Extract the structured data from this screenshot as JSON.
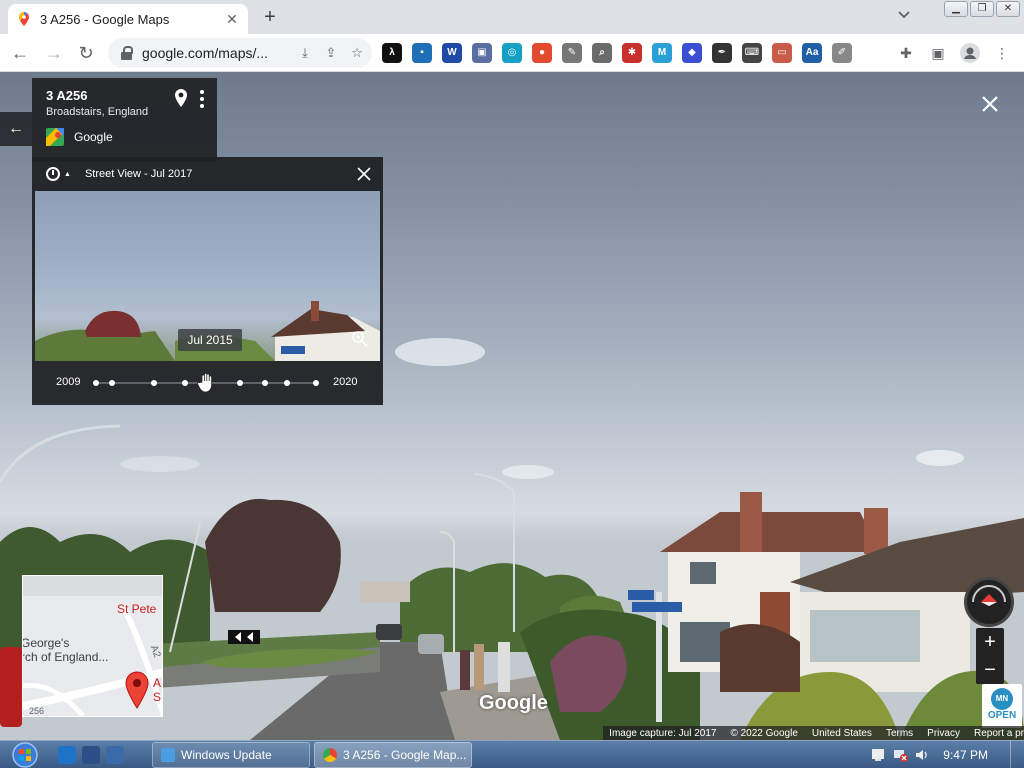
{
  "browser": {
    "tab_title": "3 A256 - Google Maps",
    "url": "google.com/maps/...",
    "new_tab_symbol": "+",
    "extensions": [
      {
        "name": "lambda-extension-icon",
        "color": "#111111",
        "glyph": "λ"
      },
      {
        "name": "flag-extension-icon",
        "color": "#1e6fb5",
        "glyph": "▪"
      },
      {
        "name": "w-extension-icon",
        "color": "#1f4aa8",
        "glyph": "W"
      },
      {
        "name": "chat-extension-icon",
        "color": "#5a6ea3",
        "glyph": "▣"
      },
      {
        "name": "camera-extension-icon",
        "color": "#15a0c6",
        "glyph": "◎"
      },
      {
        "name": "colorpicker-extension-icon",
        "color": "#e24a2f",
        "glyph": "●"
      },
      {
        "name": "pen-extension-icon",
        "color": "#777777",
        "glyph": "✎"
      },
      {
        "name": "magnifier-extension-icon",
        "color": "#6b6b6b",
        "glyph": "⌕"
      },
      {
        "name": "bug-extension-icon",
        "color": "#c7302b",
        "glyph": "✱"
      },
      {
        "name": "mn-extension-icon",
        "color": "#2a9fd6",
        "glyph": "M"
      },
      {
        "name": "cube-extension-icon",
        "color": "#3a4fd1",
        "glyph": "◆"
      },
      {
        "name": "feather-extension-icon",
        "color": "#333333",
        "glyph": "✒"
      },
      {
        "name": "keyboard-extension-icon",
        "color": "#444444",
        "glyph": "⌨"
      },
      {
        "name": "screen-extension-icon",
        "color": "#c95b4a",
        "glyph": "▭"
      },
      {
        "name": "font-extension-icon",
        "color": "#1f5fa6",
        "glyph": "Aa"
      },
      {
        "name": "note-extension-icon",
        "color": "#888888",
        "glyph": "✐"
      }
    ]
  },
  "maps": {
    "place": {
      "title": "3 A256",
      "subtitle": "Broadstairs, England",
      "source": "Google"
    },
    "time_panel": {
      "heading": "Street View - Jul 2017",
      "preview_date": "Jul 2015",
      "year_start": "2009",
      "year_end": "2020",
      "selected_position": 0.5
    },
    "minimap": {
      "label_top": "St Pete",
      "label_left_line1": "George's",
      "label_left_line2": "rch of England...",
      "label_right_line1": "A",
      "label_right_line2": "S",
      "road_label": "A2",
      "road_label2": "256"
    },
    "zoom_in": "+",
    "zoom_out": "−",
    "open_badge_line1": "MN",
    "open_badge_line2": "OPEN",
    "watermark": "Google",
    "footer": {
      "capture": "Image capture: Jul 2017",
      "copyright": "© 2022 Google",
      "country": "United States",
      "terms": "Terms",
      "privacy": "Privacy",
      "report": "Report a pr"
    }
  },
  "taskbar": {
    "windows_update": "Windows Update",
    "chrome_window": "3 A256 - Google Map...",
    "clock": "9:47 PM"
  }
}
